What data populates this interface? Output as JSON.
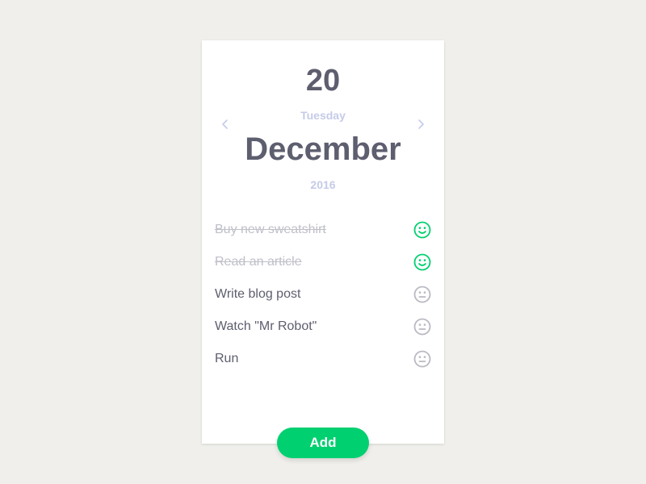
{
  "date": {
    "day": "20",
    "weekday": "Tuesday",
    "month": "December",
    "year": "2016"
  },
  "nav": {
    "prev_icon": "chevron-left-icon",
    "next_icon": "chevron-right-icon"
  },
  "tasks": [
    {
      "label": "Buy new sweatshirt",
      "done": true,
      "status_icon": "smiley-happy-icon"
    },
    {
      "label": "Read an article",
      "done": true,
      "status_icon": "smiley-happy-icon"
    },
    {
      "label": "Write blog post",
      "done": false,
      "status_icon": "smiley-neutral-icon"
    },
    {
      "label": "Watch \"Mr Robot\"",
      "done": false,
      "status_icon": "smiley-neutral-icon"
    },
    {
      "label": "Run",
      "done": false,
      "status_icon": "smiley-neutral-icon"
    }
  ],
  "add_button": {
    "label": "Add"
  },
  "colors": {
    "background": "#f0efeb",
    "card": "#ffffff",
    "text_dark": "#5d5e6e",
    "text_light": "#c5cbe8",
    "done_text": "#bfc0c8",
    "accent_green": "#00d070",
    "neutral_icon": "#b9bac3"
  }
}
